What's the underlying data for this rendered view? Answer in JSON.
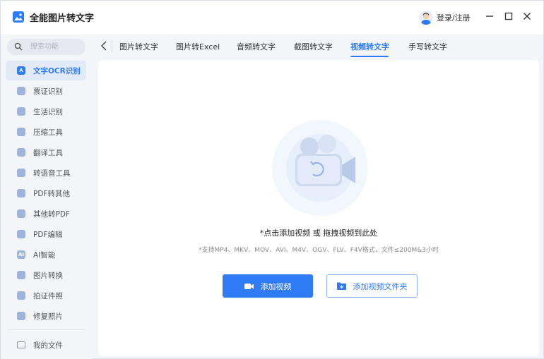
{
  "app": {
    "title": "全能图片转文字",
    "login": "登录/注册"
  },
  "window_controls": {
    "minimize": "—",
    "maximize": "☐",
    "close": "✕"
  },
  "search": {
    "placeholder": "搜索功能"
  },
  "sidebar": {
    "items": [
      {
        "label": "文字OCR识别",
        "icon": "A",
        "active": true
      },
      {
        "label": "票证识别",
        "icon": ""
      },
      {
        "label": "生活识别",
        "icon": ""
      },
      {
        "label": "压缩工具",
        "icon": ""
      },
      {
        "label": "翻译工具",
        "icon": ""
      },
      {
        "label": "转语音工具",
        "icon": ""
      },
      {
        "label": "PDF转其他",
        "icon": ""
      },
      {
        "label": "其他转PDF",
        "icon": ""
      },
      {
        "label": "PDF编辑",
        "icon": ""
      },
      {
        "label": "AI智能",
        "icon": "AI"
      },
      {
        "label": "图片转换",
        "icon": ""
      },
      {
        "label": "拍证件照",
        "icon": ""
      },
      {
        "label": "修复照片",
        "icon": ""
      }
    ],
    "files": "我的文件"
  },
  "tabs": [
    "图片转文字",
    "图片转Excel",
    "音频转文字",
    "截图转文字",
    "视频转文字",
    "手写转文字"
  ],
  "active_tab": "视频转文字",
  "upload": {
    "hint": "*点击添加视频 或 拖拽视频到此处",
    "formats": "*支持MP4、MKV、MOV、AVI、M4V、OGV、FLV、F4V格式，文件≤200M&3小时",
    "add_button": "添加视频",
    "add_folder_button": "添加视频文件夹"
  },
  "colors": {
    "accent": "#2f7bf5",
    "sidebar_bg": "#f3f5f9"
  }
}
